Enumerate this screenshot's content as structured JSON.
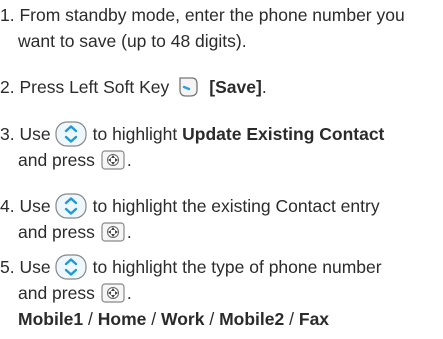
{
  "steps": [
    {
      "num": "1.",
      "line1": "From standby mode, enter the phone number you",
      "line2": "want to save (up to 48 digits)."
    },
    {
      "num": "2.",
      "pre": "Press Left Soft Key",
      "bold": "[Save]",
      "post": "."
    },
    {
      "num": "3.",
      "pre": "Use",
      "mid": "to highlight",
      "bold": "Update Existing Contact",
      "line2_pre": "and press",
      "line2_post": "."
    },
    {
      "num": "4.",
      "pre": "Use",
      "mid": "to highlight the existing Contact entry",
      "line2_pre": "and press",
      "line2_post": "."
    },
    {
      "num": "5.",
      "pre": "Use",
      "mid": "to highlight the type of phone number",
      "line2_pre": "and press",
      "line2_post": ".",
      "options": [
        "Mobile1",
        "Home",
        "Work",
        "Mobile2",
        "Fax"
      ],
      "separator": "/"
    }
  ],
  "icons": {
    "nav": "navigation-key-icon",
    "softkey": "left-soft-key-icon",
    "ok": "ok-key-icon"
  }
}
